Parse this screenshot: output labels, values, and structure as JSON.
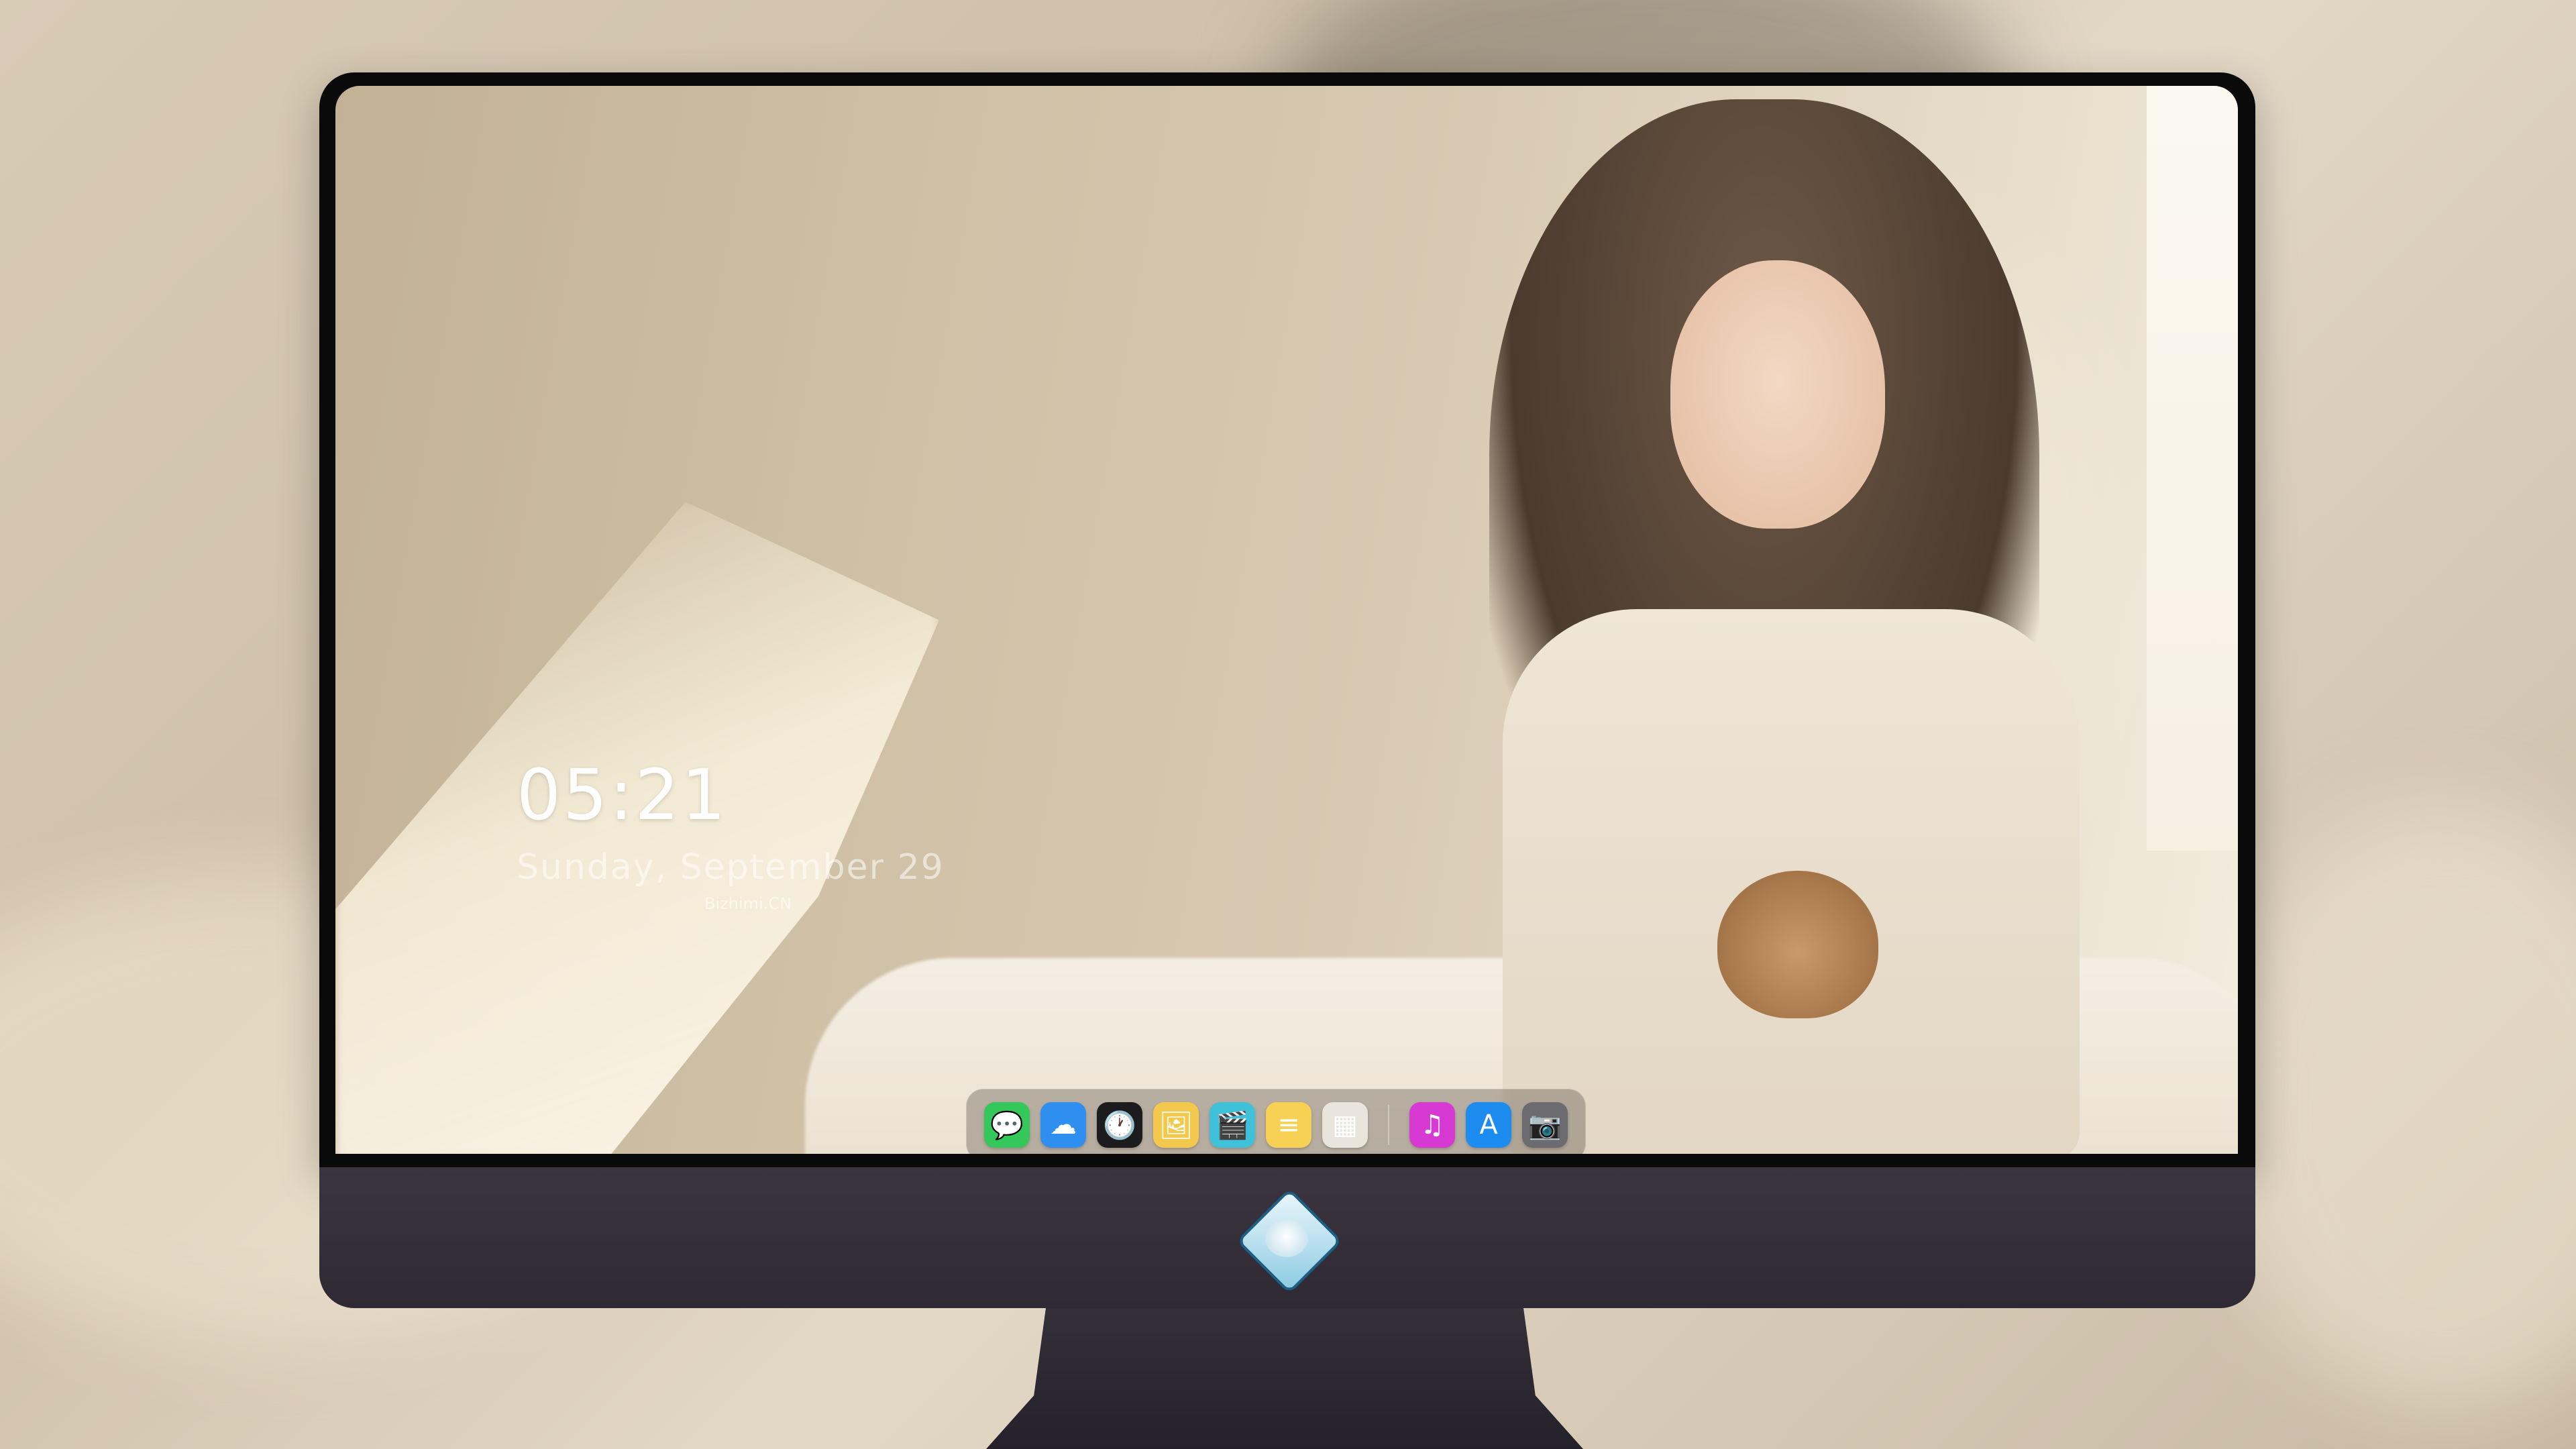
{
  "lock_screen": {
    "time": "05:21",
    "date": "Sunday, September 29",
    "credit": "Bizhimi.CN"
  },
  "dock": {
    "apps": [
      {
        "name": "Messages",
        "icon": "messages-icon",
        "glyph": "💬",
        "color": "#34c759"
      },
      {
        "name": "Weather",
        "icon": "weather-icon",
        "glyph": "☁",
        "color": "#2f8ff0"
      },
      {
        "name": "Clock",
        "icon": "clock-icon",
        "glyph": "🕐",
        "color": "#1c1c1e"
      },
      {
        "name": "Preview",
        "icon": "preview-icon",
        "glyph": "🖼",
        "color": "#f2c94c"
      },
      {
        "name": "Clips",
        "icon": "clips-icon",
        "glyph": "🎬",
        "color": "#3fc2d9"
      },
      {
        "name": "Notes",
        "icon": "notes-icon",
        "glyph": "≡",
        "color": "#f7d154"
      },
      {
        "name": "Photos",
        "icon": "photos-icon",
        "glyph": "▦",
        "color": "#e9e4dc"
      },
      {
        "name": "Music",
        "icon": "music-icon",
        "glyph": "♫",
        "color": "#d63ad3"
      },
      {
        "name": "App Store",
        "icon": "app-store-icon",
        "glyph": "A",
        "color": "#1d8cf0"
      },
      {
        "name": "Camera",
        "icon": "camera-icon",
        "glyph": "📷",
        "color": "#6b6b70"
      }
    ]
  }
}
